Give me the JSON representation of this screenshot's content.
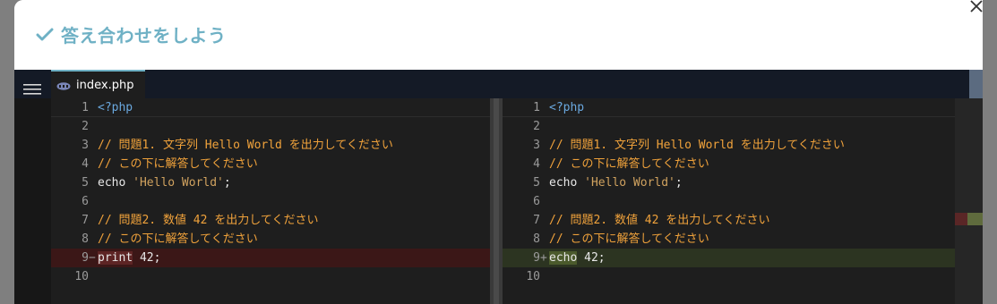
{
  "modal": {
    "title": "答え合わせをしよう",
    "check_icon": "check-icon",
    "close_icon": "close-icon"
  },
  "editor": {
    "tab": {
      "label": "index.php",
      "icon": "php-icon"
    },
    "menu_icon": "hamburger-menu-icon",
    "left": {
      "lines": [
        {
          "num": "1",
          "marker": "",
          "parts": [
            {
              "t": "<?php",
              "c": "php"
            }
          ]
        },
        {
          "num": "2",
          "marker": "",
          "parts": []
        },
        {
          "num": "3",
          "marker": "",
          "parts": [
            {
              "t": "// 問題1. 文字列 Hello World を出力してください",
              "c": "comment"
            }
          ]
        },
        {
          "num": "4",
          "marker": "",
          "parts": [
            {
              "t": "// この下に解答してください",
              "c": "comment"
            }
          ]
        },
        {
          "num": "5",
          "marker": "",
          "parts": [
            {
              "t": "echo ",
              "c": "plain"
            },
            {
              "t": "'Hello World'",
              "c": "string"
            },
            {
              "t": ";",
              "c": "plain"
            }
          ]
        },
        {
          "num": "6",
          "marker": "",
          "parts": []
        },
        {
          "num": "7",
          "marker": "",
          "parts": [
            {
              "t": "// 問題2. 数値 42 を出力してください",
              "c": "comment"
            }
          ]
        },
        {
          "num": "8",
          "marker": "",
          "parts": [
            {
              "t": "// この下に解答してください",
              "c": "comment"
            }
          ]
        },
        {
          "num": "9",
          "marker": "−",
          "diff": "del",
          "parts": [
            {
              "t": "print",
              "c": "plain",
              "hl": true
            },
            {
              "t": " 42;",
              "c": "plain"
            }
          ]
        },
        {
          "num": "10",
          "marker": "",
          "parts": []
        }
      ]
    },
    "right": {
      "lines": [
        {
          "num": "1",
          "marker": "",
          "parts": [
            {
              "t": "<?php",
              "c": "php"
            }
          ]
        },
        {
          "num": "2",
          "marker": "",
          "parts": []
        },
        {
          "num": "3",
          "marker": "",
          "parts": [
            {
              "t": "// 問題1. 文字列 Hello World を出力してください",
              "c": "comment"
            }
          ]
        },
        {
          "num": "4",
          "marker": "",
          "parts": [
            {
              "t": "// この下に解答してください",
              "c": "comment"
            }
          ]
        },
        {
          "num": "5",
          "marker": "",
          "parts": [
            {
              "t": "echo ",
              "c": "plain"
            },
            {
              "t": "'Hello World'",
              "c": "string"
            },
            {
              "t": ";",
              "c": "plain"
            }
          ]
        },
        {
          "num": "6",
          "marker": "",
          "parts": []
        },
        {
          "num": "7",
          "marker": "",
          "parts": [
            {
              "t": "// 問題2. 数値 42 を出力してください",
              "c": "comment"
            }
          ]
        },
        {
          "num": "8",
          "marker": "",
          "parts": [
            {
              "t": "// この下に解答してください",
              "c": "comment"
            }
          ]
        },
        {
          "num": "9",
          "marker": "+",
          "diff": "add",
          "parts": [
            {
              "t": "echo",
              "c": "plain",
              "hl": true
            },
            {
              "t": " 42;",
              "c": "plain"
            }
          ]
        },
        {
          "num": "10",
          "marker": "",
          "parts": []
        }
      ]
    }
  }
}
